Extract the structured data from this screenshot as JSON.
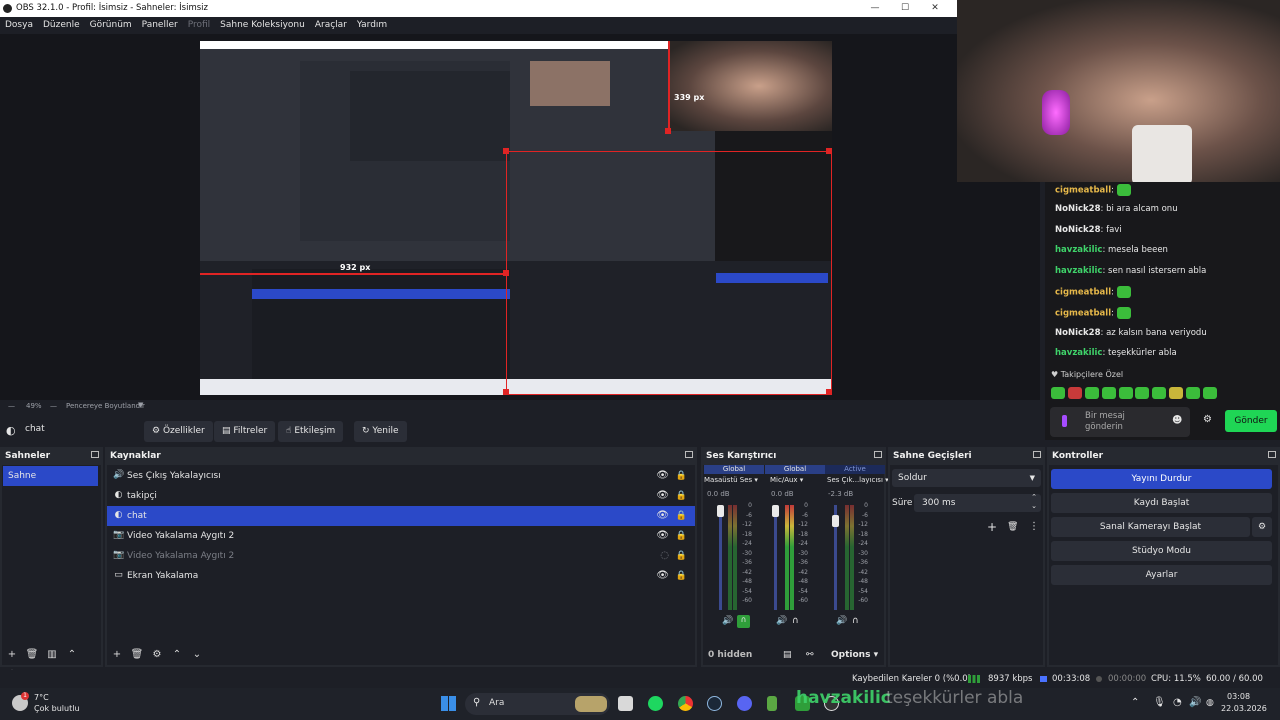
{
  "window": {
    "title": "OBS 32.1.0 - Profil: İsimsiz - Sahneler: İsimsiz",
    "controls": [
      "—",
      "☐",
      "✕"
    ]
  },
  "menu": {
    "items": [
      "Dosya",
      "Düzenle",
      "Görünüm",
      "Paneller",
      "Profil",
      "Sahne Koleksiyonu",
      "Araçlar",
      "Yardım"
    ],
    "disabled_index": 4
  },
  "preview": {
    "label_339": "339 px",
    "label_932": "932 px"
  },
  "chat": {
    "messages": [
      {
        "user": "cigmeatball",
        "text": "",
        "emote": true,
        "color": "#e6b84a"
      },
      {
        "user": "NoNick28",
        "text": "bi ara alcam onu",
        "color": "#ffffff"
      },
      {
        "user": "NoNick28",
        "text": "favi",
        "color": "#ffffff"
      },
      {
        "user": "havzakilic",
        "text": "mesela beeen",
        "color": "#3fd36a"
      },
      {
        "user": "havzakilic",
        "text": "sen nasıl istersern abla",
        "color": "#3fd36a"
      },
      {
        "user": "cigmeatball",
        "text": "",
        "emote": true,
        "color": "#e6b84a"
      },
      {
        "user": "cigmeatball",
        "text": "",
        "emote": true,
        "color": "#e6b84a"
      },
      {
        "user": "NoNick28",
        "text": "az kalsın bana veriyodu",
        "color": "#ffffff"
      },
      {
        "user": "havzakilic",
        "text": "teşekkürler abla",
        "color": "#3fd36a"
      }
    ],
    "subscriber_label": "Takipçilere Özel",
    "input_placeholder": "Bir mesaj gönderin",
    "send_label": "Gönder"
  },
  "zoombar": {
    "zoom": "49%",
    "fit": "Pencereye Boyutlandır"
  },
  "source_toolbar": {
    "current": "chat",
    "buttons": [
      "Özellikler",
      "Filtreler",
      "Etkileşim",
      "Yenile"
    ]
  },
  "scenes": {
    "title": "Sahneler",
    "items": [
      "Sahne"
    ]
  },
  "sources": {
    "title": "Kaynaklar",
    "items": [
      {
        "name": "Ses Çıkış Yakalayıcısı",
        "icon": "speaker-icon",
        "dim": false
      },
      {
        "name": "takipçi",
        "icon": "browser-icon",
        "dim": false
      },
      {
        "name": "chat",
        "icon": "browser-icon",
        "dim": false,
        "selected": true
      },
      {
        "name": "Video Yakalama Aygıtı 2",
        "icon": "camera-icon",
        "dim": false
      },
      {
        "name": "Video Yakalama Aygıtı 2",
        "icon": "camera-icon",
        "dim": true
      },
      {
        "name": "Ekran Yakalama",
        "icon": "monitor-icon",
        "dim": false
      }
    ]
  },
  "mixer": {
    "title": "Ses Karıştırıcı",
    "channels": [
      {
        "tag": "Global",
        "name": "Masaüstü Ses",
        "db": "0.0 dB",
        "level": 0.0
      },
      {
        "tag": "Global",
        "name": "Mic/Aux",
        "db": "0.0 dB",
        "level": 0.45
      },
      {
        "tag": "Active",
        "name": "Ses Çık...layıcısı",
        "db": "-2.3 dB",
        "level": 0.0
      }
    ],
    "scale": [
      "0",
      "-6",
      "-12",
      "-18",
      "-24",
      "-30",
      "-36",
      "-42",
      "-48",
      "-54",
      "-60"
    ],
    "hidden": "0 hidden",
    "options": "Options"
  },
  "transitions": {
    "title": "Sahne Geçişleri",
    "type": "Soldur",
    "duration_label": "Süre",
    "duration": "300 ms"
  },
  "controls": {
    "title": "Kontroller",
    "stop_stream": "Yayını Durdur",
    "start_record": "Kaydı Başlat",
    "virtual_cam": "Sanal Kamerayı Başlat",
    "studio": "Stüdyo Modu",
    "settings": "Ayarlar"
  },
  "status": {
    "dropped": "Kaybedilen Kareler 0 (%0.0)",
    "bitrate": "8937 kbps",
    "stream_time": "00:33:08",
    "rec_time": "00:00:00",
    "cpu": "CPU: 11.5%",
    "fps": "60.00 / 60.00 FPS"
  },
  "taskbar": {
    "weather_temp": "7°C",
    "weather_text": "Çok bulutlu",
    "search": "Ara",
    "ticker_user": "havzakilic",
    "ticker_text": "teşekkürler abla",
    "time": "03:08",
    "date": "22.03.2026"
  },
  "colors": {
    "accent": "#2b49c8",
    "selection": "#e02424",
    "chat_green": "#3fd36a",
    "send_button": "#1fd655"
  }
}
